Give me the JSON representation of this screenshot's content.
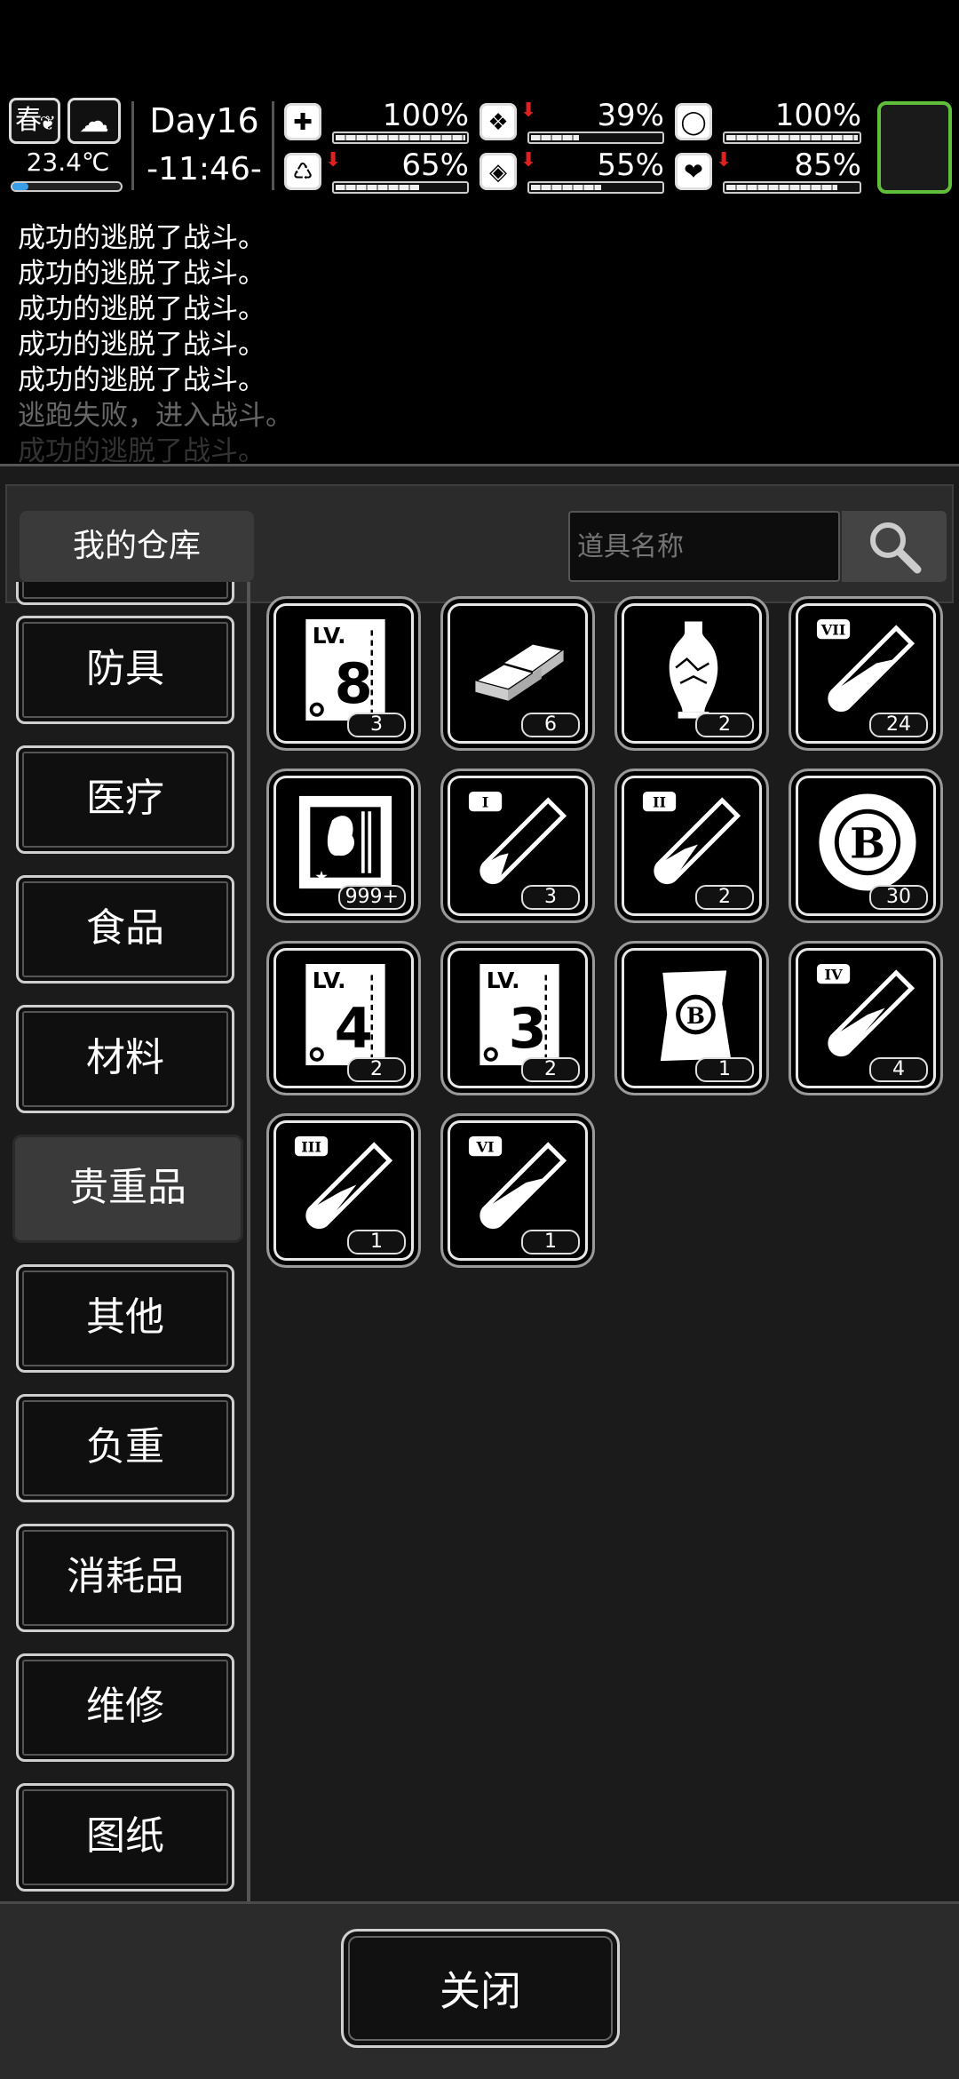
{
  "status": {
    "season": "春",
    "temperature": "23.4℃",
    "temperature_level": 0.15,
    "day": "Day16",
    "time": "-11:46-",
    "stats": [
      {
        "icon": "medkit-icon",
        "value": "100%",
        "level": 1.0,
        "down": false
      },
      {
        "icon": "stomach-icon",
        "value": "39%",
        "level": 0.39,
        "down": true
      },
      {
        "icon": "capsule-icon",
        "value": "100%",
        "level": 1.0,
        "down": false
      },
      {
        "icon": "boot-icon",
        "value": "65%",
        "level": 0.65,
        "down": true
      },
      {
        "icon": "water-drop-icon",
        "value": "55%",
        "level": 0.55,
        "down": true
      },
      {
        "icon": "heart-icon",
        "value": "85%",
        "level": 0.85,
        "down": true
      }
    ]
  },
  "log": [
    "成功的逃脱了战斗。",
    "成功的逃脱了战斗。",
    "成功的逃脱了战斗。",
    "成功的逃脱了战斗。",
    "成功的逃脱了战斗。",
    "逃跑失败，进入战斗。",
    "成功的逃脱了战斗。"
  ],
  "warehouse": {
    "title": "我的仓库",
    "search_placeholder": "道具名称",
    "categories": [
      "防具",
      "医疗",
      "食品",
      "材料",
      "贵重品",
      "其他",
      "负重",
      "消耗品",
      "维修",
      "图纸"
    ],
    "active_category": "贵重品",
    "items": [
      {
        "icon": "skill-book-lv8-icon",
        "label": "8",
        "count": "3"
      },
      {
        "icon": "gold-bars-icon",
        "label": "",
        "count": "6"
      },
      {
        "icon": "vase-icon",
        "label": "",
        "count": "2"
      },
      {
        "icon": "potion-vii-icon",
        "label": "VII",
        "count": "24"
      },
      {
        "icon": "poster-icon",
        "label": "",
        "count": "999+"
      },
      {
        "icon": "potion-i-icon",
        "label": "I",
        "count": "3"
      },
      {
        "icon": "potion-ii-icon",
        "label": "II",
        "count": "2"
      },
      {
        "icon": "b-coin-icon",
        "label": "B",
        "count": "30"
      },
      {
        "icon": "skill-book-lv4-icon",
        "label": "4",
        "count": "2"
      },
      {
        "icon": "skill-book-lv3-icon",
        "label": "3",
        "count": "2"
      },
      {
        "icon": "b-scroll-icon",
        "label": "B",
        "count": "1"
      },
      {
        "icon": "potion-iv-icon",
        "label": "IV",
        "count": "4"
      },
      {
        "icon": "potion-iii-icon",
        "label": "III",
        "count": "1"
      },
      {
        "icon": "potion-vi-icon",
        "label": "VI",
        "count": "1"
      }
    ],
    "close_label": "关闭"
  }
}
